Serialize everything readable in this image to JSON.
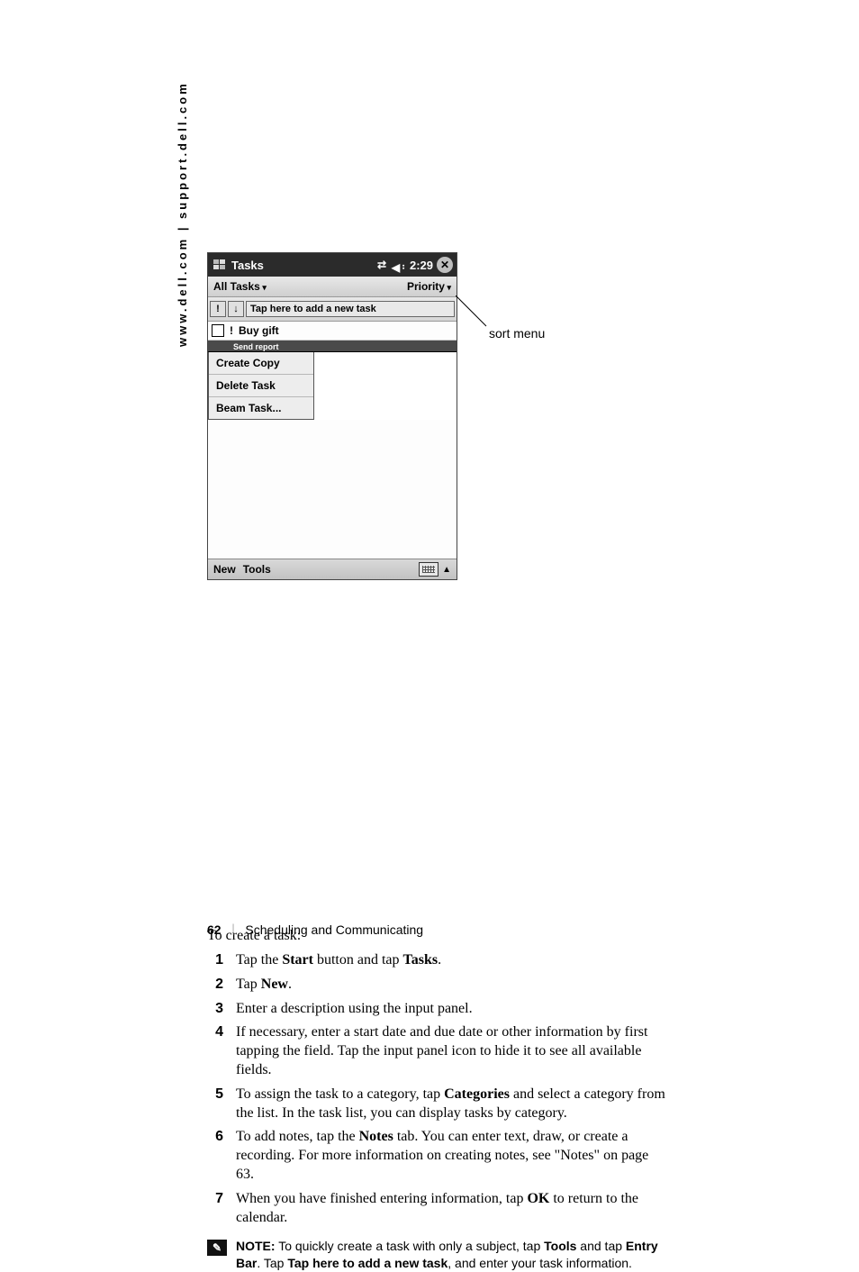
{
  "side_url": "www.dell.com | support.dell.com",
  "screenshot": {
    "title": "Tasks",
    "time": "2:29",
    "filter_left": "All Tasks",
    "filter_right": "Priority",
    "entry_hint": "Tap here to add a new task",
    "priority_icon": "!",
    "arrow_icon": "↓",
    "task1": "Buy gift",
    "task2_partial": "Send report",
    "menu": {
      "item1": "Create Copy",
      "item2": "Delete Task",
      "item3": "Beam Task..."
    },
    "bottom_new": "New",
    "bottom_tools": "Tools"
  },
  "callout": "sort menu",
  "intro": "To create a task:",
  "steps": {
    "s1": {
      "n": "1",
      "pre": "Tap the ",
      "b1": "Start",
      "mid": " button and tap ",
      "b2": "Tasks",
      "post": "."
    },
    "s2": {
      "n": "2",
      "pre": "Tap ",
      "b1": "New",
      "post": "."
    },
    "s3": {
      "n": "3",
      "txt": "Enter a description using the input panel."
    },
    "s4": {
      "n": "4",
      "txt": "If necessary, enter a start date and due date or other information by first tapping the field. Tap the input panel icon to hide it to see all available fields."
    },
    "s5": {
      "n": "5",
      "pre": "To assign the task to a category, tap ",
      "b1": "Categories",
      "post": " and select a category from the list. In the task list, you can display tasks by category."
    },
    "s6": {
      "n": "6",
      "pre": "To add notes, tap the ",
      "b1": "Notes",
      "post": " tab. You can enter text, draw, or create a recording. For more information on creating notes, see \"Notes\" on page 63."
    },
    "s7": {
      "n": "7",
      "pre": "When you have finished entering information, tap ",
      "b1": "OK",
      "post": " to return to the calendar."
    }
  },
  "note": {
    "label": "NOTE:",
    "t1": " To quickly create a task with only a subject, tap ",
    "b1": "Tools",
    "t2": " and tap ",
    "b2": "Entry Bar",
    "t3": ". Tap ",
    "b3": "Tap here to add a new task",
    "t4": ", and enter your task information."
  },
  "footer": {
    "page": "62",
    "section": "Scheduling and Communicating"
  }
}
